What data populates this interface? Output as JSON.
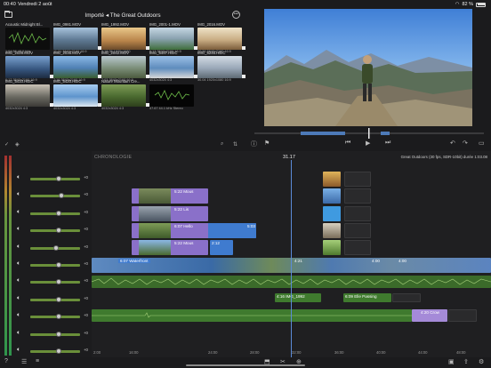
{
  "status": {
    "time": "00:40",
    "date": "Vendredi 2 août",
    "battery": "82 %"
  },
  "browser": {
    "title": "Importé ◂ The Great Outdoors",
    "clips": [
      {
        "name": "Acoustic Midnight Bl...",
        "meta": "1:04:58  48.0 kHz",
        "color": "#111"
      },
      {
        "name": "IMG_0981.MOV",
        "meta": "11:21  3840x2160  16:9",
        "color": "#6d8aa6"
      },
      {
        "name": "IMG_1992.MOV",
        "meta": "9:18.05  1920x1080",
        "color": "#c9a56b"
      },
      {
        "name": "IMG_2001-1.MOV",
        "meta": "6:17  3840x2160  16:9",
        "color": "#8fa9b6"
      },
      {
        "name": "IMG_2016.MOV",
        "meta": "20:26  3840x2160  16:9",
        "color": "#c9b796"
      },
      {
        "name": "IMG_2028.MOV",
        "meta": "6:17  3840x2160  16:9",
        "color": "#4f6e9a"
      },
      {
        "name": "IMG_2035.MOV",
        "meta": "7:16  3840x2160  16:9",
        "color": "#5f8cbc"
      },
      {
        "name": "IMG_2042.MOV",
        "meta": "7:03  3840x2160  16:9",
        "color": "#889c7a"
      },
      {
        "name": "IMG_5497.HEIC",
        "meta": "4032x3024  4:3",
        "color": "#7096c0"
      },
      {
        "name": "IMG_5246.HEIC",
        "meta": "30.04  1920x1080  16:9",
        "color": "#9aa8b8"
      },
      {
        "name": "IMG_5410.HEIC",
        "meta": "4032x3024  4:3",
        "color": "#5a5a55"
      },
      {
        "name": "IMG_5420.HEIC",
        "meta": "4032x3024  4:3",
        "color": "#7ca6d6"
      },
      {
        "name": "Nature Mountain Cre...",
        "meta": "4032x3024  4:3",
        "color": "#4f6e34"
      },
      {
        "name": "",
        "meta": "47.67  44.1 kHz  Stereo",
        "color": "#000"
      }
    ]
  },
  "viewer": {
    "scene": "hiker on mountain trail"
  },
  "timeline": {
    "label": "CHRONOLOGIE",
    "timecode": "31.17",
    "project_info": "Great Outdoors (30 fps, SDR-10bit) durée 1:03.08",
    "mixer_rows": [
      {
        "gain": "+0",
        "knob": 0.55
      },
      {
        "gain": "+0",
        "knob": 0.6
      },
      {
        "gain": "+0",
        "knob": 0.55
      },
      {
        "gain": "+0",
        "knob": 0.55
      },
      {
        "gain": "+0",
        "knob": 0.5
      },
      {
        "gain": "+0",
        "knob": 0.55
      },
      {
        "gain": "+0",
        "knob": 0.55
      },
      {
        "gain": "+0",
        "knob": 0.55
      },
      {
        "gain": "+0",
        "knob": 0.55
      },
      {
        "gain": "+0",
        "knob": 0.55
      },
      {
        "gain": "+0",
        "knob": 0.55
      }
    ],
    "clips": {
      "c1": "5:22  Mous",
      "c2": "5:22  Lis",
      "c3": "6:07  Hello",
      "c3b": "5:03",
      "c4": "5:22  Mous",
      "c4b": "2:12",
      "c5": "6:07  Waterfront",
      "c5b": "4:21",
      "c5c": "4:00",
      "c5d": "4:00",
      "a1": "4:16  IMG_1992",
      "a2": "6:09  Elle Passing",
      "a3": "4:20  Crow"
    },
    "ruler": [
      "2:00",
      "16:00",
      "24:00",
      "28:00",
      "32:00",
      "36:00",
      "40:00",
      "44:00",
      "48:00"
    ]
  }
}
